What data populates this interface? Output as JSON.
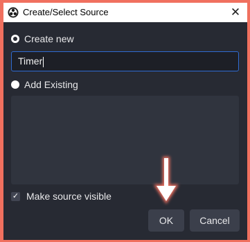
{
  "window": {
    "title": "Create/Select Source",
    "close_glyph": "✕"
  },
  "options": {
    "create_new_label": "Create new",
    "create_new_selected": true,
    "name_value": "Timer",
    "add_existing_label": "Add Existing",
    "add_existing_selected": false,
    "existing_sources": []
  },
  "make_visible": {
    "label": "Make source visible",
    "checked": true,
    "check_glyph": "✓"
  },
  "buttons": {
    "ok_label": "OK",
    "cancel_label": "Cancel"
  },
  "icons": {
    "app": "obs-logo-icon",
    "close": "close-icon",
    "annotation": "arrow-down-icon"
  },
  "colors": {
    "page_border": "#f0705f",
    "dialog_bg": "#272a33",
    "input_focus": "#2f6bd1",
    "button_bg": "#3b3f4b"
  }
}
